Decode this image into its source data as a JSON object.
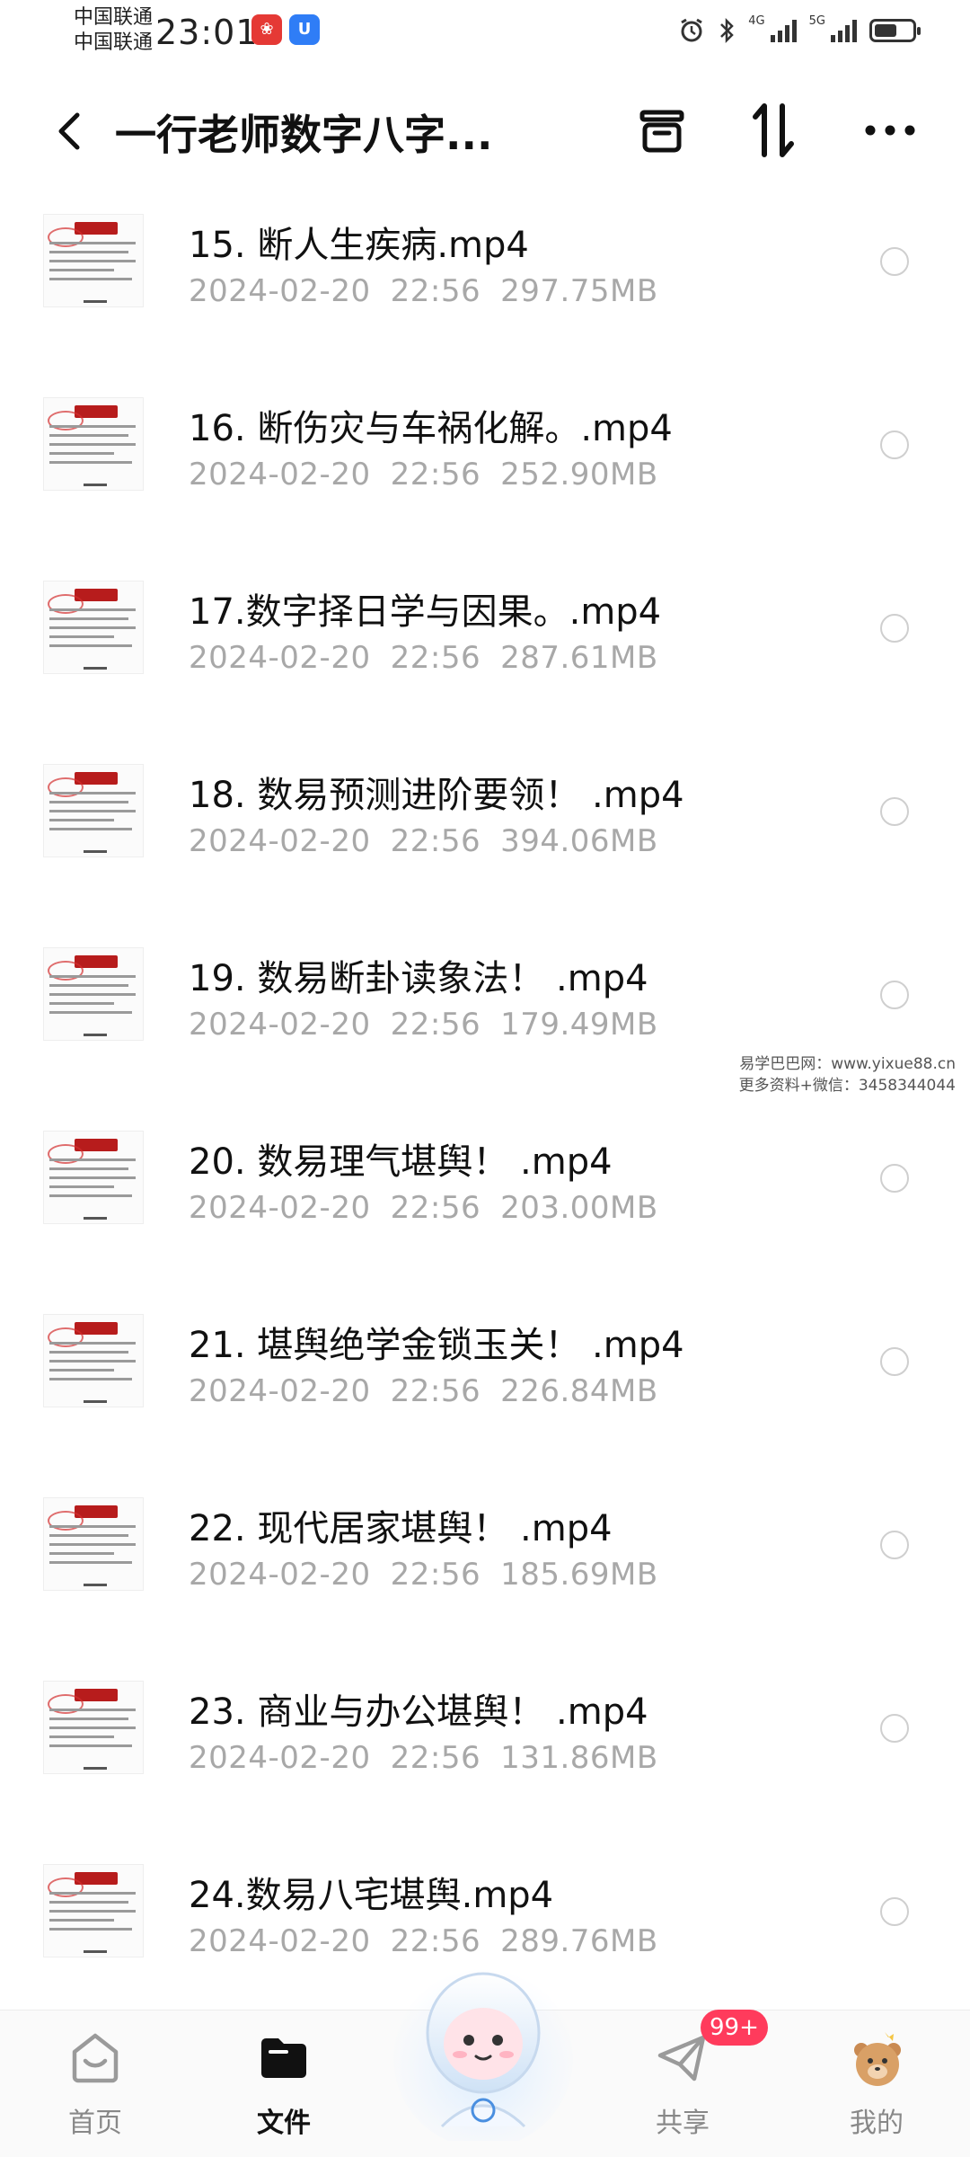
{
  "status": {
    "carrier1": "中国联通",
    "carrier2": "中国联通",
    "time": "23:01",
    "sig1": "4G",
    "sig2": "5G",
    "battery_level": 0.6
  },
  "header": {
    "title": "一行老师数字八字..."
  },
  "files": [
    {
      "name": "15. 断人生疾病.mp4",
      "date": "2024-02-20",
      "time": "22:56",
      "size": "297.75MB"
    },
    {
      "name": "16. 断伤灾与车祸化解。.mp4",
      "date": "2024-02-20",
      "time": "22:56",
      "size": "252.90MB"
    },
    {
      "name": "17.数字择日学与因果。.mp4",
      "date": "2024-02-20",
      "time": "22:56",
      "size": "287.61MB"
    },
    {
      "name": "18. 数易预测进阶要领！ .mp4",
      "date": "2024-02-20",
      "time": "22:56",
      "size": "394.06MB"
    },
    {
      "name": "19. 数易断卦读象法！ .mp4",
      "date": "2024-02-20",
      "time": "22:56",
      "size": "179.49MB"
    },
    {
      "name": "20. 数易理气堪舆！ .mp4",
      "date": "2024-02-20",
      "time": "22:56",
      "size": "203.00MB"
    },
    {
      "name": "21. 堪舆绝学金锁玉关！ .mp4",
      "date": "2024-02-20",
      "time": "22:56",
      "size": "226.84MB"
    },
    {
      "name": "22. 现代居家堪舆！ .mp4",
      "date": "2024-02-20",
      "time": "22:56",
      "size": "185.69MB"
    },
    {
      "name": "23. 商业与办公堪舆！ .mp4",
      "date": "2024-02-20",
      "time": "22:56",
      "size": "131.86MB"
    },
    {
      "name": "24.数易八宅堪舆.mp4",
      "date": "2024-02-20",
      "time": "22:56",
      "size": "289.76MB"
    }
  ],
  "watermark": {
    "line1": "易学巴巴网：www.yixue88.cn",
    "line2": "更多资料+微信：3458344044"
  },
  "nav": {
    "home": "首页",
    "files": "文件",
    "share": "共享",
    "mine": "我的",
    "badge": "99+"
  }
}
